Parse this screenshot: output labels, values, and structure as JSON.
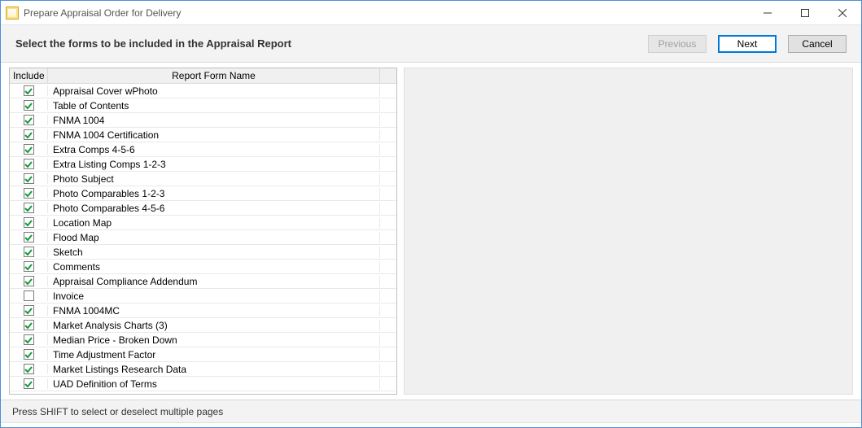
{
  "window": {
    "title": "Prepare Appraisal Order for Delivery"
  },
  "header": {
    "instruction": "Select the forms to be included in the Appraisal Report",
    "buttons": {
      "previous": "Previous",
      "next": "Next",
      "cancel": "Cancel"
    }
  },
  "grid": {
    "columns": {
      "include": "Include",
      "name": "Report Form Name"
    },
    "rows": [
      {
        "checked": true,
        "name": "Appraisal Cover wPhoto"
      },
      {
        "checked": true,
        "name": "Table of Contents"
      },
      {
        "checked": true,
        "name": "FNMA 1004"
      },
      {
        "checked": true,
        "name": "FNMA 1004 Certification"
      },
      {
        "checked": true,
        "name": "Extra Comps 4-5-6"
      },
      {
        "checked": true,
        "name": "Extra Listing Comps 1-2-3"
      },
      {
        "checked": true,
        "name": "Photo Subject"
      },
      {
        "checked": true,
        "name": "Photo Comparables 1-2-3"
      },
      {
        "checked": true,
        "name": "Photo Comparables 4-5-6"
      },
      {
        "checked": true,
        "name": "Location Map"
      },
      {
        "checked": true,
        "name": "Flood Map"
      },
      {
        "checked": true,
        "name": "Sketch"
      },
      {
        "checked": true,
        "name": "Comments"
      },
      {
        "checked": true,
        "name": "Appraisal Compliance Addendum"
      },
      {
        "checked": false,
        "name": "Invoice"
      },
      {
        "checked": true,
        "name": "FNMA 1004MC"
      },
      {
        "checked": true,
        "name": "Market Analysis Charts (3)"
      },
      {
        "checked": true,
        "name": "Median Price - Broken Down"
      },
      {
        "checked": true,
        "name": "Time Adjustment Factor"
      },
      {
        "checked": true,
        "name": "Market Listings Research Data"
      },
      {
        "checked": true,
        "name": "UAD Definition of Terms"
      }
    ]
  },
  "footer": {
    "hint": "Press SHIFT to select or deselect multiple pages"
  }
}
